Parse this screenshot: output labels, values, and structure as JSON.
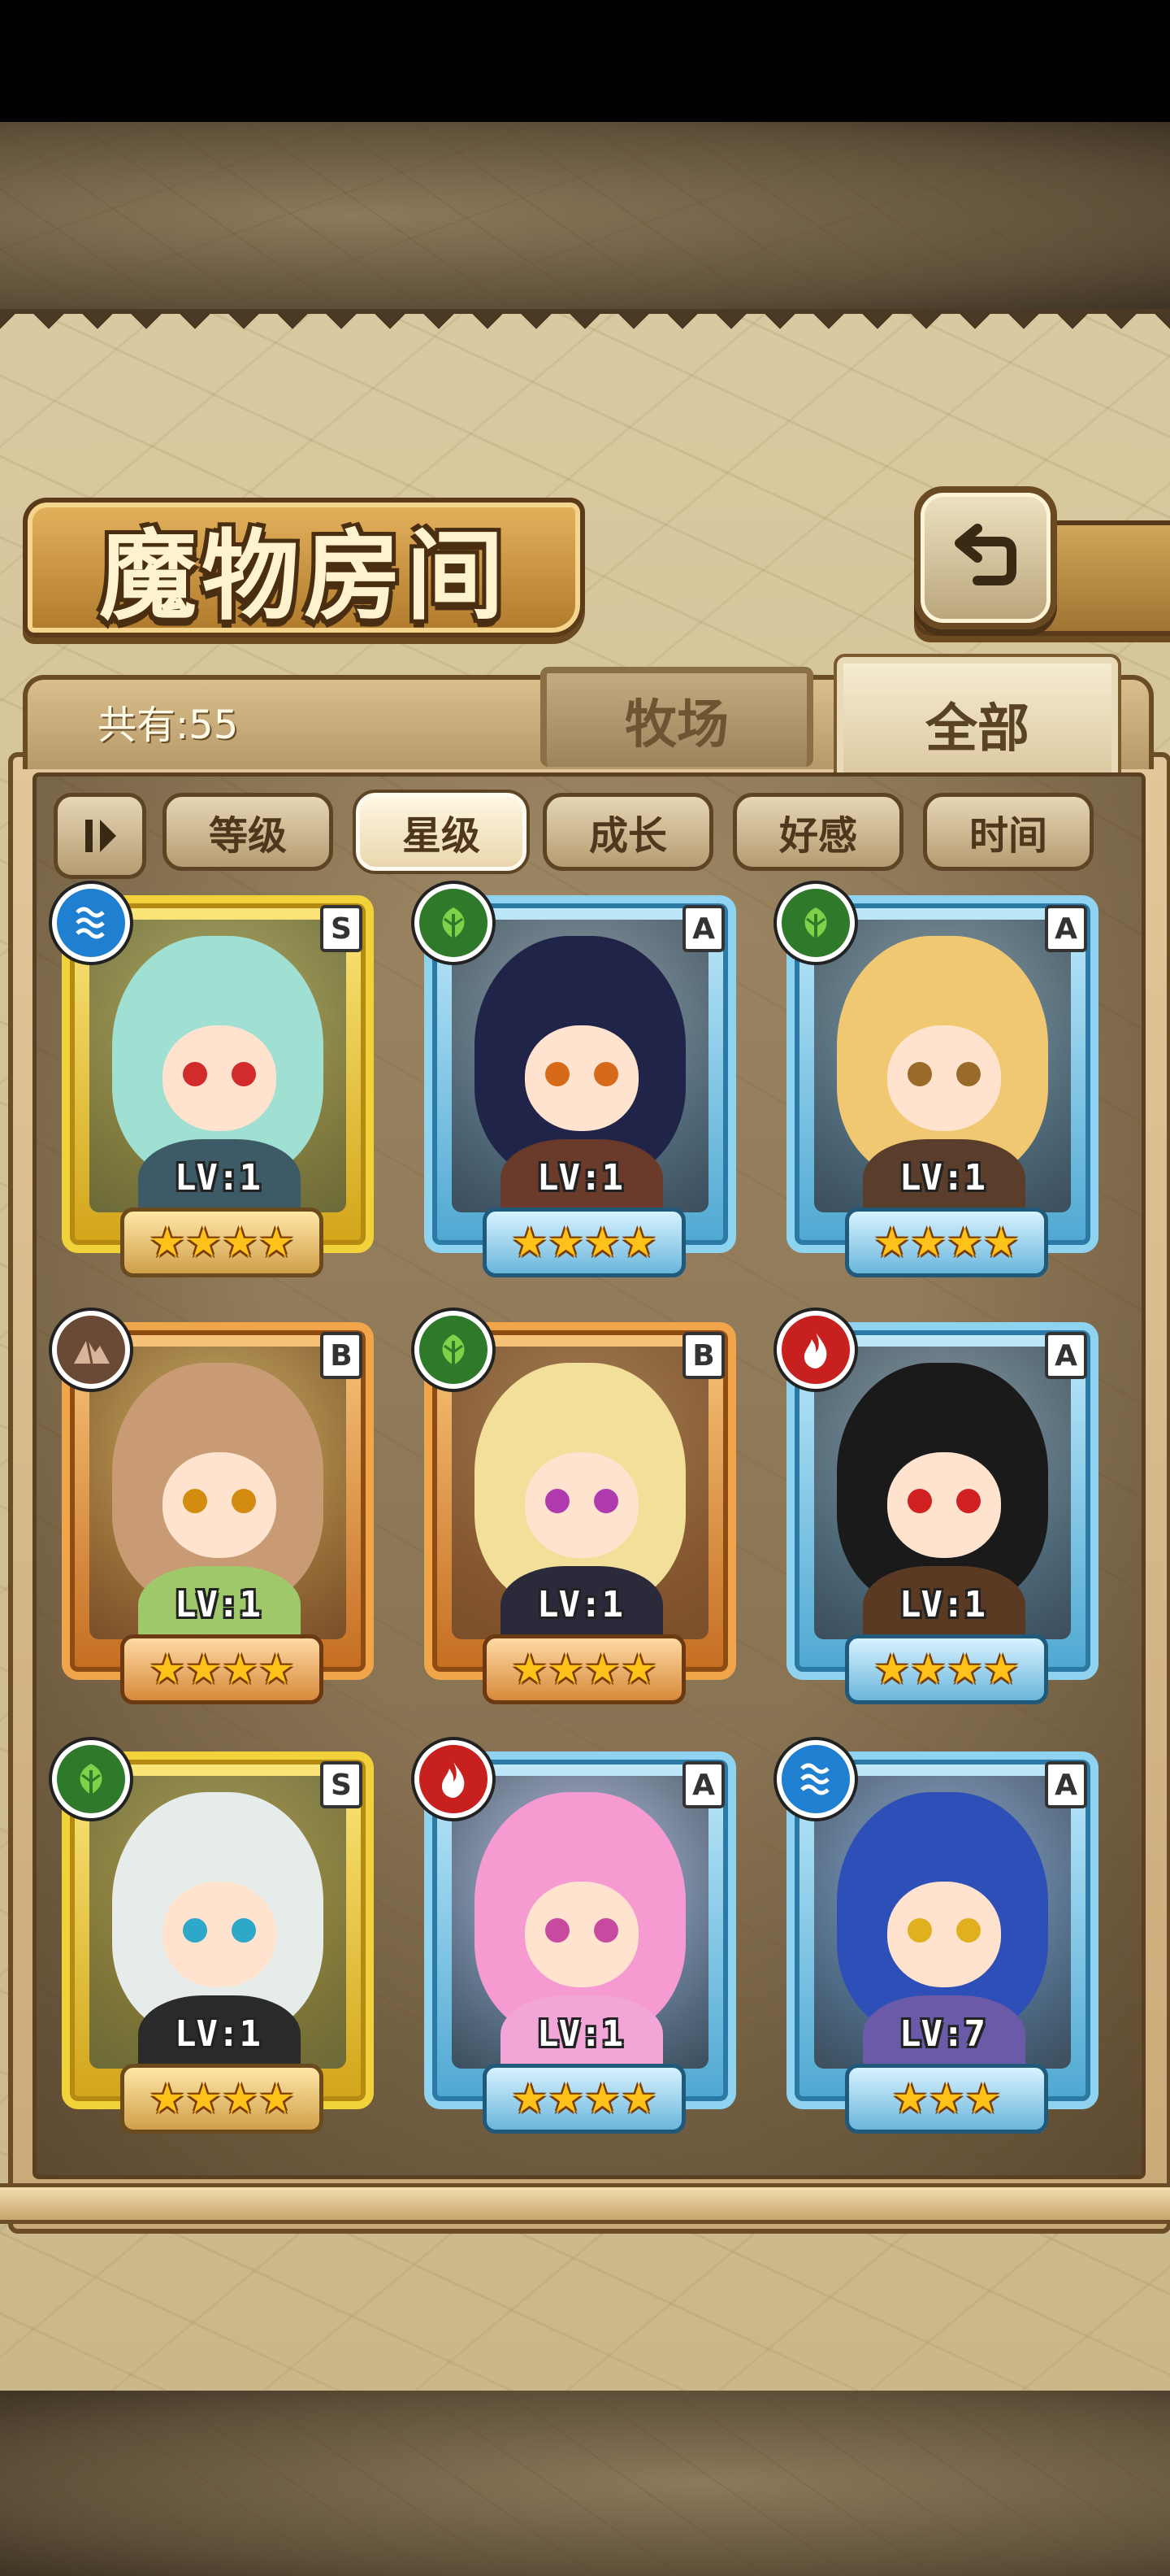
{
  "header": {
    "title": "魔物房间"
  },
  "summary": {
    "count_text": "共有:55"
  },
  "tabs": [
    {
      "label": "牧场",
      "active": false
    },
    {
      "label": "全部",
      "active": true
    }
  ],
  "filters": [
    {
      "label": "等级",
      "active": false
    },
    {
      "label": "星级",
      "active": true
    },
    {
      "label": "成长",
      "active": false
    },
    {
      "label": "好感",
      "active": false
    },
    {
      "label": "时间",
      "active": false
    }
  ],
  "monsters": [
    {
      "rank": "S",
      "element": "water",
      "level": "LV:1",
      "stars": "★★★★",
      "star_count": 4,
      "colors": {
        "hair": "#9fe0d2",
        "eye": "#d22b2b",
        "body": "#3c5b66"
      }
    },
    {
      "rank": "A",
      "element": "nature",
      "level": "LV:1",
      "stars": "★★★★",
      "star_count": 4,
      "colors": {
        "hair": "#1f2448",
        "eye": "#d76a18",
        "body": "#6a3a2a"
      }
    },
    {
      "rank": "A",
      "element": "nature",
      "level": "LV:1",
      "stars": "★★★★",
      "star_count": 4,
      "colors": {
        "hair": "#f0c872",
        "eye": "#9a6a2a",
        "body": "#5a3d2a"
      }
    },
    {
      "rank": "B",
      "element": "earth",
      "level": "LV:1",
      "stars": "★★★★",
      "star_count": 4,
      "colors": {
        "hair": "#c89b74",
        "eye": "#d38b10",
        "body": "#9fc86a"
      }
    },
    {
      "rank": "B",
      "element": "nature",
      "level": "LV:1",
      "stars": "★★★★",
      "star_count": 4,
      "colors": {
        "hair": "#f2df9a",
        "eye": "#b03ab0",
        "body": "#2a2a3a"
      }
    },
    {
      "rank": "A",
      "element": "fire",
      "level": "LV:1",
      "stars": "★★★★",
      "star_count": 4,
      "colors": {
        "hair": "#1a1a1a",
        "eye": "#d02020",
        "body": "#5b3a24"
      }
    },
    {
      "rank": "S",
      "element": "nature",
      "level": "LV:1",
      "stars": "★★★★",
      "star_count": 4,
      "colors": {
        "hair": "#e6ecea",
        "eye": "#2ea8c8",
        "body": "#2b2b2b"
      }
    },
    {
      "rank": "A",
      "element": "fire",
      "level": "LV:1",
      "stars": "★★★★",
      "star_count": 4,
      "colors": {
        "hair": "#f59bd2",
        "eye": "#c84aa0",
        "body": "#f2a6d8"
      }
    },
    {
      "rank": "A",
      "element": "water",
      "level": "LV:7",
      "stars": "★★★",
      "star_count": 3,
      "colors": {
        "hair": "#2e4fb8",
        "eye": "#e0b020",
        "body": "#6a5aa8"
      }
    }
  ],
  "colors": {
    "rank_S": "#f2d23a",
    "rank_A": "#8fd3f0",
    "rank_B": "#f0a54a",
    "element_water": "#1f7fd1",
    "element_nature": "#2f7a2a",
    "element_earth": "#6a4a36",
    "element_fire": "#c81f1f"
  },
  "icons": {
    "back": "return-arrow-icon",
    "filter_toggle": "sort-toggle-icon",
    "water": "water-waves-icon",
    "nature": "leaf-icon",
    "earth": "mountain-icon",
    "fire": "flame-icon"
  }
}
